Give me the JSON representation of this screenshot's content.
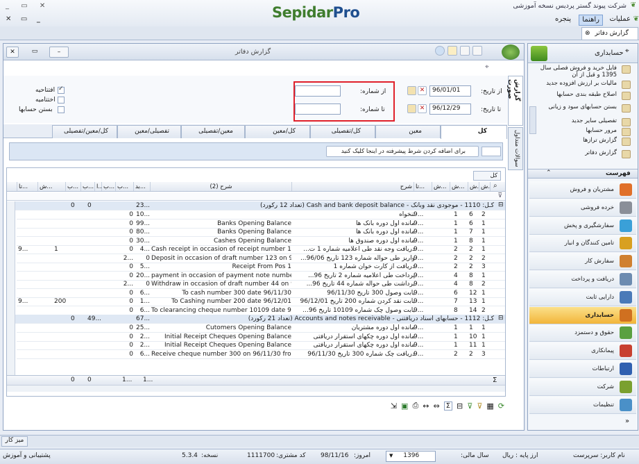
{
  "app": {
    "logo_a": "Sepidar",
    "logo_b": "Pro",
    "company_title": "شرکت پیوند گستر پردیس نسخه آموزشی"
  },
  "menubar": {
    "items": [
      "عملیات",
      "راهنما",
      "پنجره"
    ],
    "active_index": 1
  },
  "doc_tab": {
    "label": "گزارش دفاتر"
  },
  "report": {
    "title": "گزارش دفاتر",
    "side_tab": "گزارش صورت",
    "side_tab2": "سوالات متداول",
    "filters": {
      "from_date_label": "از تاریخ:",
      "from_date": "96/01/01",
      "to_date_label": "تا تاریخ:",
      "to_date": "96/12/29",
      "from_num_label": "از شماره:",
      "to_num_label": "تا شماره:",
      "from_num": "",
      "to_num": "",
      "checks": [
        {
          "label": "افتتاحیه",
          "checked": true
        },
        {
          "label": "اختتامیه",
          "checked": false
        },
        {
          "label": "بستن حسابها",
          "checked": false
        }
      ]
    },
    "tabs": [
      "کل",
      "معین",
      "کل/تفصیلی",
      "کل/معین",
      "معین/تفصیلی",
      "تفصیلی/معین",
      "کل/معین/تفصیلی"
    ],
    "active_tab": 0,
    "condition_text": "برای اضافه کردن شرط پیشرفته در اینجا کلیک کنید",
    "group_label": "کل",
    "sum_symbol": "Σ",
    "columns_right": [
      "ش...",
      "ش...",
      "ش...",
      "ش...",
      "تا...",
      "شرح"
    ],
    "column_desc2": "شرح (2)",
    "columns_left": [
      "بد...",
      "ب...",
      "ب...",
      "ا...",
      "ب...",
      "ب...",
      "ش...",
      "تا..."
    ],
    "groups": [
      {
        "header": "کـل: 1110 - موجودی نقد وبانک - Cash and bank deposit balance (تعداد 12 رکورد)",
        "totals": [
          "23...",
          "0",
          "0"
        ],
        "rows": [
          {
            "c": [
              "2",
              "6",
              "1",
              "9..."
            ],
            "desc": "تنخواه",
            "desc2": "",
            "deb": "10...",
            "b2": "0",
            "extra": [
              "",
              "",
              ""
            ]
          },
          {
            "c": [
              "1",
              "6",
              "1",
              "9..."
            ],
            "desc": "مانده اول دوره بانک ها",
            "desc2": "Banks  Opening Balance",
            "deb": "99...",
            "b2": "0",
            "extra": [
              "",
              "",
              ""
            ]
          },
          {
            "c": [
              "1",
              "7",
              "1",
              "9..."
            ],
            "desc": "مانده اول دوره بانک ها",
            "desc2": "Banks  Opening Balance",
            "deb": "80...",
            "b2": "0",
            "extra": [
              "",
              "",
              ""
            ]
          },
          {
            "c": [
              "1",
              "8",
              "1",
              "9..."
            ],
            "desc": "مانده اول دوره صندوق ها",
            "desc2": "Cashes  Opening Balance",
            "deb": "30...",
            "b2": "0",
            "extra": [
              "",
              "",
              ""
            ]
          },
          {
            "c": [
              "1",
              "2",
              "2",
              "9..."
            ],
            "desc": "دریافت وجه نقد طی اعلامیه شماره 1 ت...",
            "desc2": "Cash receipt in occasion of receipt number 1 on",
            "deb": "4...",
            "b2": "0",
            "extra": [
              "1",
              "",
              "9..."
            ]
          },
          {
            "c": [
              "2",
              "2",
              "2",
              "9..."
            ],
            "desc": "واریز طی حواله شماره 123 تاریخ 96/06...",
            "desc2": "Deposit in occasion of draft number 123 on 96...",
            "deb": "0",
            "b2": "2...",
            "extra": [
              "",
              "",
              ""
            ]
          },
          {
            "c": [
              "3",
              "2",
              "2",
              "9..."
            ],
            "desc": "دریافت از کارت خوان شماره 1",
            "desc2": "Receipt From Pos 1",
            "deb": "5...",
            "b2": "0",
            "extra": [
              "",
              "",
              ""
            ]
          },
          {
            "c": [
              "1",
              "8",
              "4",
              "9..."
            ],
            "desc": "پرداخت طی اعلامیه شماره 2 تاریخ 96...",
            "desc2": "payment in occasion of payment note number 2...",
            "deb": "20...",
            "b2": "0",
            "extra": [
              "",
              "",
              ""
            ]
          },
          {
            "c": [
              "2",
              "8",
              "4",
              "9..."
            ],
            "desc": "برداشت طی حواله شماره 44 تاریخ 96...",
            "desc2": "Withdraw in occasion of draft number 44 on 96...",
            "deb": "0",
            "b2": "2...",
            "extra": [
              "",
              "",
              ""
            ]
          },
          {
            "c": [
              "1",
              "12",
              "6",
              "9..."
            ],
            "desc": "بابت وصول 300 تاریخ 96/11/30",
            "desc2": "To cash number 300 date 96/11/30",
            "deb": "6...",
            "b2": "0",
            "extra": [
              "",
              "",
              ""
            ]
          },
          {
            "c": [
              "1",
              "13",
              "7",
              "9..."
            ],
            "desc": "بابت نقد کردن شماره 200 تاریخ 96/12/01",
            "desc2": "To Cashing number 200 date 96/12/01",
            "deb": "1...",
            "b2": "0",
            "extra": [
              "200",
              "",
              "9..."
            ]
          },
          {
            "c": [
              "2",
              "14",
              "8",
              "9..."
            ],
            "desc": "بابت وصول چک شماره 10109 تاریخ 96...",
            "desc2": "To clearancing cheque number 10109 date 96...",
            "deb": "6...",
            "b2": "0",
            "extra": [
              "",
              "",
              ""
            ]
          }
        ]
      },
      {
        "header": "کـل: 1112 - حسابهای اسناد دریافتنی - Accounts and notes receivable (تعداد 21 رکورد)",
        "totals": [
          "67...",
          "49...",
          "0"
        ],
        "rows": [
          {
            "c": [
              "1",
              "1",
              "1",
              "9..."
            ],
            "desc": "مانده اول دوره مشتریان",
            "desc2": "Cutomers Opening Balance",
            "deb": "25...",
            "b2": "0",
            "extra": [
              "",
              "",
              ""
            ]
          },
          {
            "c": [
              "1",
              "10",
              "1",
              "9..."
            ],
            "desc": "مانده اول دوره چکهای استقرار دریافتی",
            "desc2": "Initial Receipt Cheques Opening Balance",
            "deb": "2...",
            "b2": "0",
            "extra": [
              "",
              "",
              ""
            ]
          },
          {
            "c": [
              "1",
              "11",
              "1",
              "9..."
            ],
            "desc": "مانده اول دوره چکهای استقرار دریافتی",
            "desc2": "Initial Receipt Cheques Opening Balance",
            "deb": "2...",
            "b2": "0",
            "extra": [
              "",
              "",
              ""
            ]
          },
          {
            "c": [
              "3",
              "2",
              "2",
              "9..."
            ],
            "desc": "دریافت چک شماره 300 تاریخ 96/11/30",
            "desc2": "Receive cheque number 300 on 96/11/30 from",
            "deb": "6...",
            "b2": "0",
            "extra": [
              "",
              "",
              ""
            ]
          }
        ]
      }
    ],
    "footer_totals": [
      "1...",
      "1...",
      "0",
      "0"
    ]
  },
  "sidebar": {
    "header": "حسابداری",
    "items": [
      "فایل خرید و فروش فصلی سال 1395 و قبل از آن",
      "مالیات بر ارزش افزوده جدید",
      "اصلاح طبقه بندی حسابها",
      "بستن حسابهای سود و زیانی",
      "تفصیلی سایر جدید",
      "مرور حسابها",
      "گزارش ترازها",
      "گزارش دفاتر"
    ],
    "list_header": "فهرست",
    "modules": [
      {
        "label": "مشتریان و فروش",
        "color": "#e0702a"
      },
      {
        "label": "خرده فروشی",
        "color": "#8a8f98"
      },
      {
        "label": "سفارشگیری و پخش",
        "color": "#3aa0d8"
      },
      {
        "label": "تامین کنندگان و انبار",
        "color": "#d8a020"
      },
      {
        "label": "سفارش کار",
        "color": "#d08030"
      },
      {
        "label": "دریافت و پرداخت",
        "color": "#6c8bb0"
      },
      {
        "label": "دارایی ثابت",
        "color": "#4a7ab8"
      },
      {
        "label": "حسابداری",
        "color": "#d07020",
        "active": true
      },
      {
        "label": "حقوق و دستمزد",
        "color": "#5aa040"
      },
      {
        "label": "پیمانکاری",
        "color": "#c84030"
      },
      {
        "label": "ارتباطات",
        "color": "#3060b0"
      },
      {
        "label": "شرکت",
        "color": "#7aa030"
      },
      {
        "label": "تنظیمات",
        "color": "#4a90c8"
      }
    ]
  },
  "desk": {
    "label": "میز کار"
  },
  "status": {
    "support": "پشتیبانی و آموزش",
    "username": "نام کاربر: سرپرست",
    "base_currency": "ارز پایه :   ریال",
    "fiscal_year_label": "سال مالی:",
    "fiscal_year": "1396",
    "today_label": "امروز:",
    "today": "98/11/16",
    "customer_code_label": "کد مشتری:",
    "customer_code": "1111700",
    "version_label": "نسخه:",
    "version": "5.3.4"
  }
}
